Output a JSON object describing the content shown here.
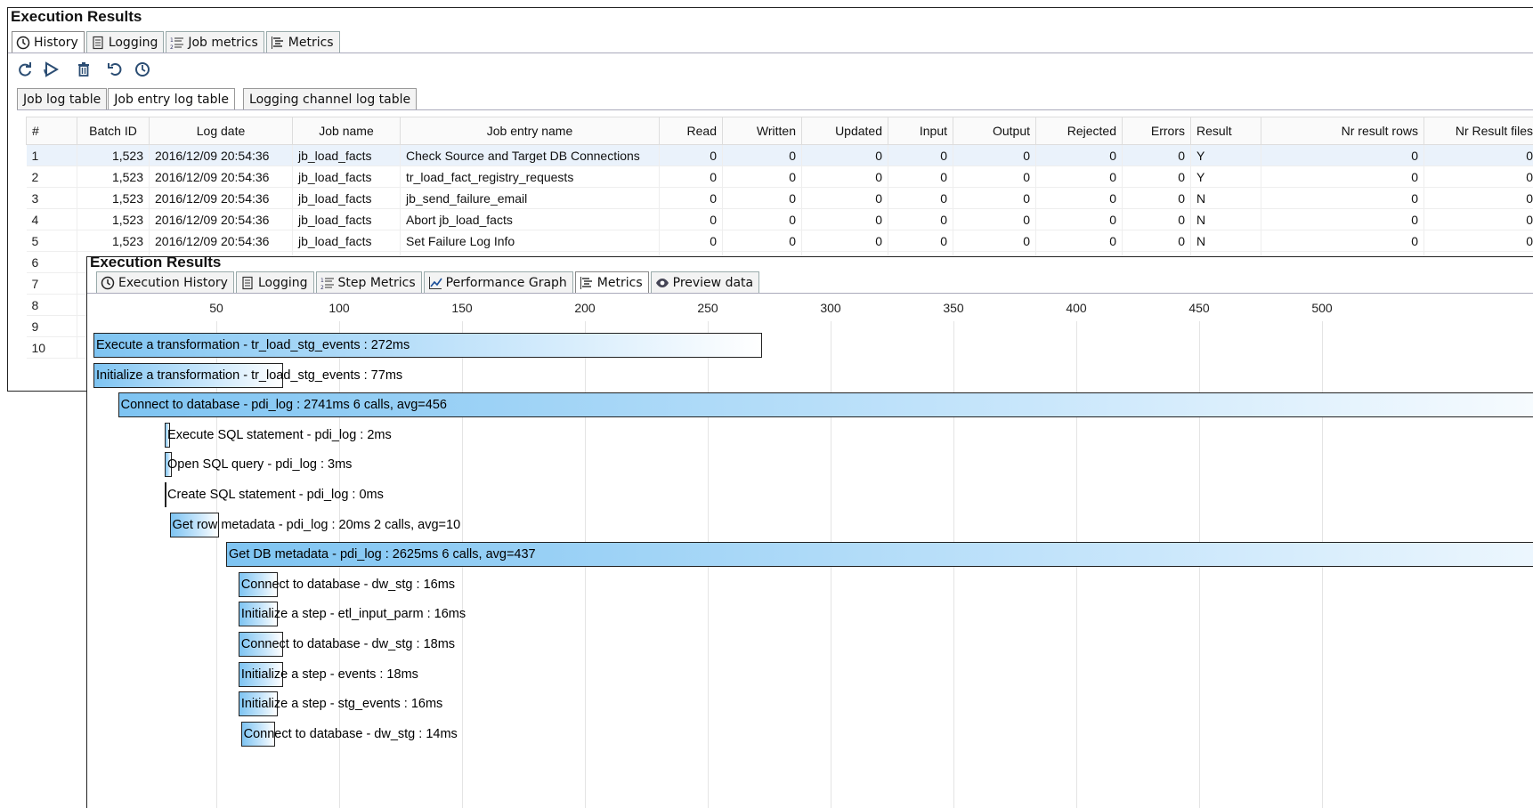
{
  "top_panel": {
    "title": "Execution Results",
    "tabs": [
      {
        "label": "History",
        "icon": "clock-icon",
        "selected": true
      },
      {
        "label": "Logging",
        "icon": "log-icon",
        "selected": false
      },
      {
        "label": "Job metrics",
        "icon": "list-numbered-icon",
        "selected": false
      },
      {
        "label": "Metrics",
        "icon": "metrics-icon",
        "selected": false
      }
    ],
    "toolbar": [
      "refresh-icon",
      "replay-icon",
      "trash-icon",
      "undo-icon",
      "history-icon"
    ],
    "subtabs": [
      {
        "label": "Job log table",
        "selected": false
      },
      {
        "label": "Job entry log table",
        "selected": true
      },
      {
        "label": "Logging channel log table",
        "selected": false
      }
    ],
    "table": {
      "columns": [
        "#",
        "Batch ID",
        "Log date",
        "Job name",
        "Job entry name",
        "Read",
        "Written",
        "Updated",
        "Input",
        "Output",
        "Rejected",
        "Errors",
        "Result",
        "Nr result rows",
        "Nr Result files"
      ],
      "rows": [
        [
          "1",
          "1,523",
          "2016/12/09 20:54:36",
          "jb_load_facts",
          "Check Source and Target DB Connections",
          "0",
          "0",
          "0",
          "0",
          "0",
          "0",
          "0",
          "Y",
          "0",
          "0"
        ],
        [
          "2",
          "1,523",
          "2016/12/09 20:54:36",
          "jb_load_facts",
          "tr_load_fact_registry_requests",
          "0",
          "0",
          "0",
          "0",
          "0",
          "0",
          "0",
          "Y",
          "0",
          "0"
        ],
        [
          "3",
          "1,523",
          "2016/12/09 20:54:36",
          "jb_load_facts",
          "jb_send_failure_email",
          "0",
          "0",
          "0",
          "0",
          "0",
          "0",
          "0",
          "N",
          "0",
          "0"
        ],
        [
          "4",
          "1,523",
          "2016/12/09 20:54:36",
          "jb_load_facts",
          "Abort jb_load_facts",
          "0",
          "0",
          "0",
          "0",
          "0",
          "0",
          "0",
          "N",
          "0",
          "0"
        ],
        [
          "5",
          "1,523",
          "2016/12/09 20:54:36",
          "jb_load_facts",
          "Set Failure Log Info",
          "0",
          "0",
          "0",
          "0",
          "0",
          "0",
          "0",
          "N",
          "0",
          "0"
        ]
      ],
      "extra_row_numbers": [
        "6",
        "7",
        "8",
        "9",
        "10"
      ]
    }
  },
  "bottom_panel": {
    "title": "Execution Results",
    "tabs": [
      {
        "label": "Execution History",
        "icon": "clock-icon",
        "selected": false
      },
      {
        "label": "Logging",
        "icon": "log-icon",
        "selected": false
      },
      {
        "label": "Step Metrics",
        "icon": "list-numbered-icon",
        "selected": false
      },
      {
        "label": "Performance Graph",
        "icon": "line-graph-icon",
        "selected": false
      },
      {
        "label": "Metrics",
        "icon": "metrics-icon",
        "selected": true
      },
      {
        "label": "Preview data",
        "icon": "eye-icon",
        "selected": false
      }
    ]
  },
  "chart_data": {
    "type": "bar",
    "orientation": "horizontal-timeline",
    "x_ticks": [
      50,
      100,
      150,
      200,
      250,
      300,
      350,
      400,
      450,
      500
    ],
    "xlim": [
      0,
      535
    ],
    "bars": [
      {
        "label": "Execute a transformation - tr_load_stg_events : 272ms",
        "start": 0,
        "duration": 272
      },
      {
        "label": "Initialize a transformation - tr_load_stg_events : 77ms",
        "start": 0,
        "duration": 77
      },
      {
        "label": "Connect to database - pdi_log : 2741ms 6 calls, avg=456",
        "start": 10,
        "duration": 2741
      },
      {
        "label": "Execute SQL statement - pdi_log : 2ms",
        "start": 29,
        "duration": 2
      },
      {
        "label": "Open SQL query - pdi_log : 3ms",
        "start": 29,
        "duration": 3
      },
      {
        "label": "Create SQL statement - pdi_log : 0ms",
        "start": 29,
        "duration": 0
      },
      {
        "label": "Get row metadata - pdi_log : 20ms 2 calls, avg=10",
        "start": 31,
        "duration": 20
      },
      {
        "label": "Get DB metadata - pdi_log : 2625ms 6 calls, avg=437",
        "start": 54,
        "duration": 2625
      },
      {
        "label": "Connect to database - dw_stg : 16ms",
        "start": 59,
        "duration": 16
      },
      {
        "label": "Initialize a step - etl_input_parm : 16ms",
        "start": 59,
        "duration": 16
      },
      {
        "label": "Connect to database - dw_stg : 18ms",
        "start": 59,
        "duration": 18
      },
      {
        "label": "Initialize a step - events : 18ms",
        "start": 59,
        "duration": 18
      },
      {
        "label": "Initialize a step - stg_events : 16ms",
        "start": 59,
        "duration": 16
      },
      {
        "label": "Connect to database - dw_stg : 14ms",
        "start": 60,
        "duration": 14
      }
    ]
  }
}
